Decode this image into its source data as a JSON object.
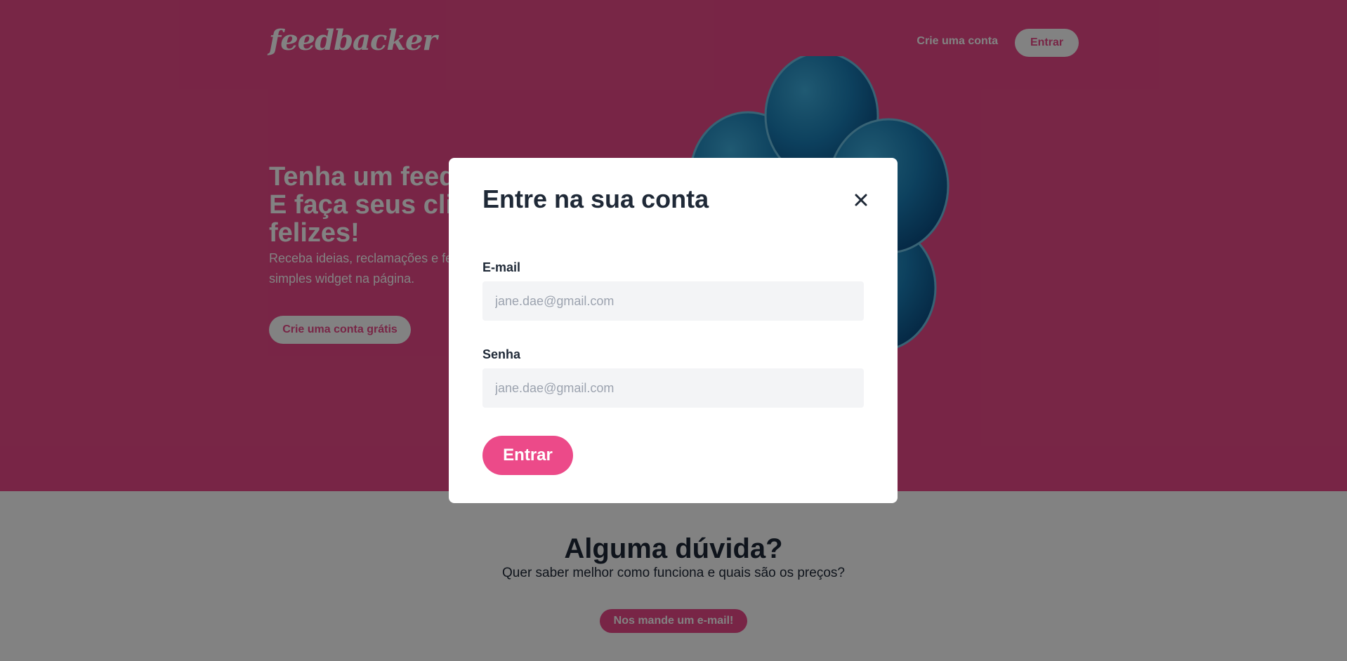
{
  "header": {
    "logo": "feedbacker",
    "create_account_link": "Crie uma conta",
    "login_button": "Entrar"
  },
  "hero": {
    "title_line1": "Tenha um feedback.",
    "title_line2": "E faça seus clientes mais",
    "title_line3": "felizes!",
    "subtitle_line1": "Receba ideias, reclamações e feedbacks com um",
    "subtitle_line2": "simples widget na página.",
    "cta_button": "Crie uma conta grátis"
  },
  "contact": {
    "title": "Alguma dúvida?",
    "subtitle": "Quer saber melhor como funciona e quais são os preços?",
    "button": "Nos mande um e-mail!"
  },
  "modal": {
    "title": "Entre na sua conta",
    "close_icon": "close-icon",
    "email_label": "E-mail",
    "email_placeholder": "jane.dae@gmail.com",
    "password_label": "Senha",
    "password_placeholder": "jane.dae@gmail.com",
    "submit_button": "Entrar"
  },
  "colors": {
    "brand_pink": "#ec4a89",
    "overlay": "rgba(0,0,0,0.49)",
    "balloon_blue": "#1a7fb8",
    "text_dark": "#1f2937",
    "input_bg": "#f3f4f6"
  },
  "icons": {
    "balloons": "balloons-illustration",
    "close": "close-icon"
  }
}
